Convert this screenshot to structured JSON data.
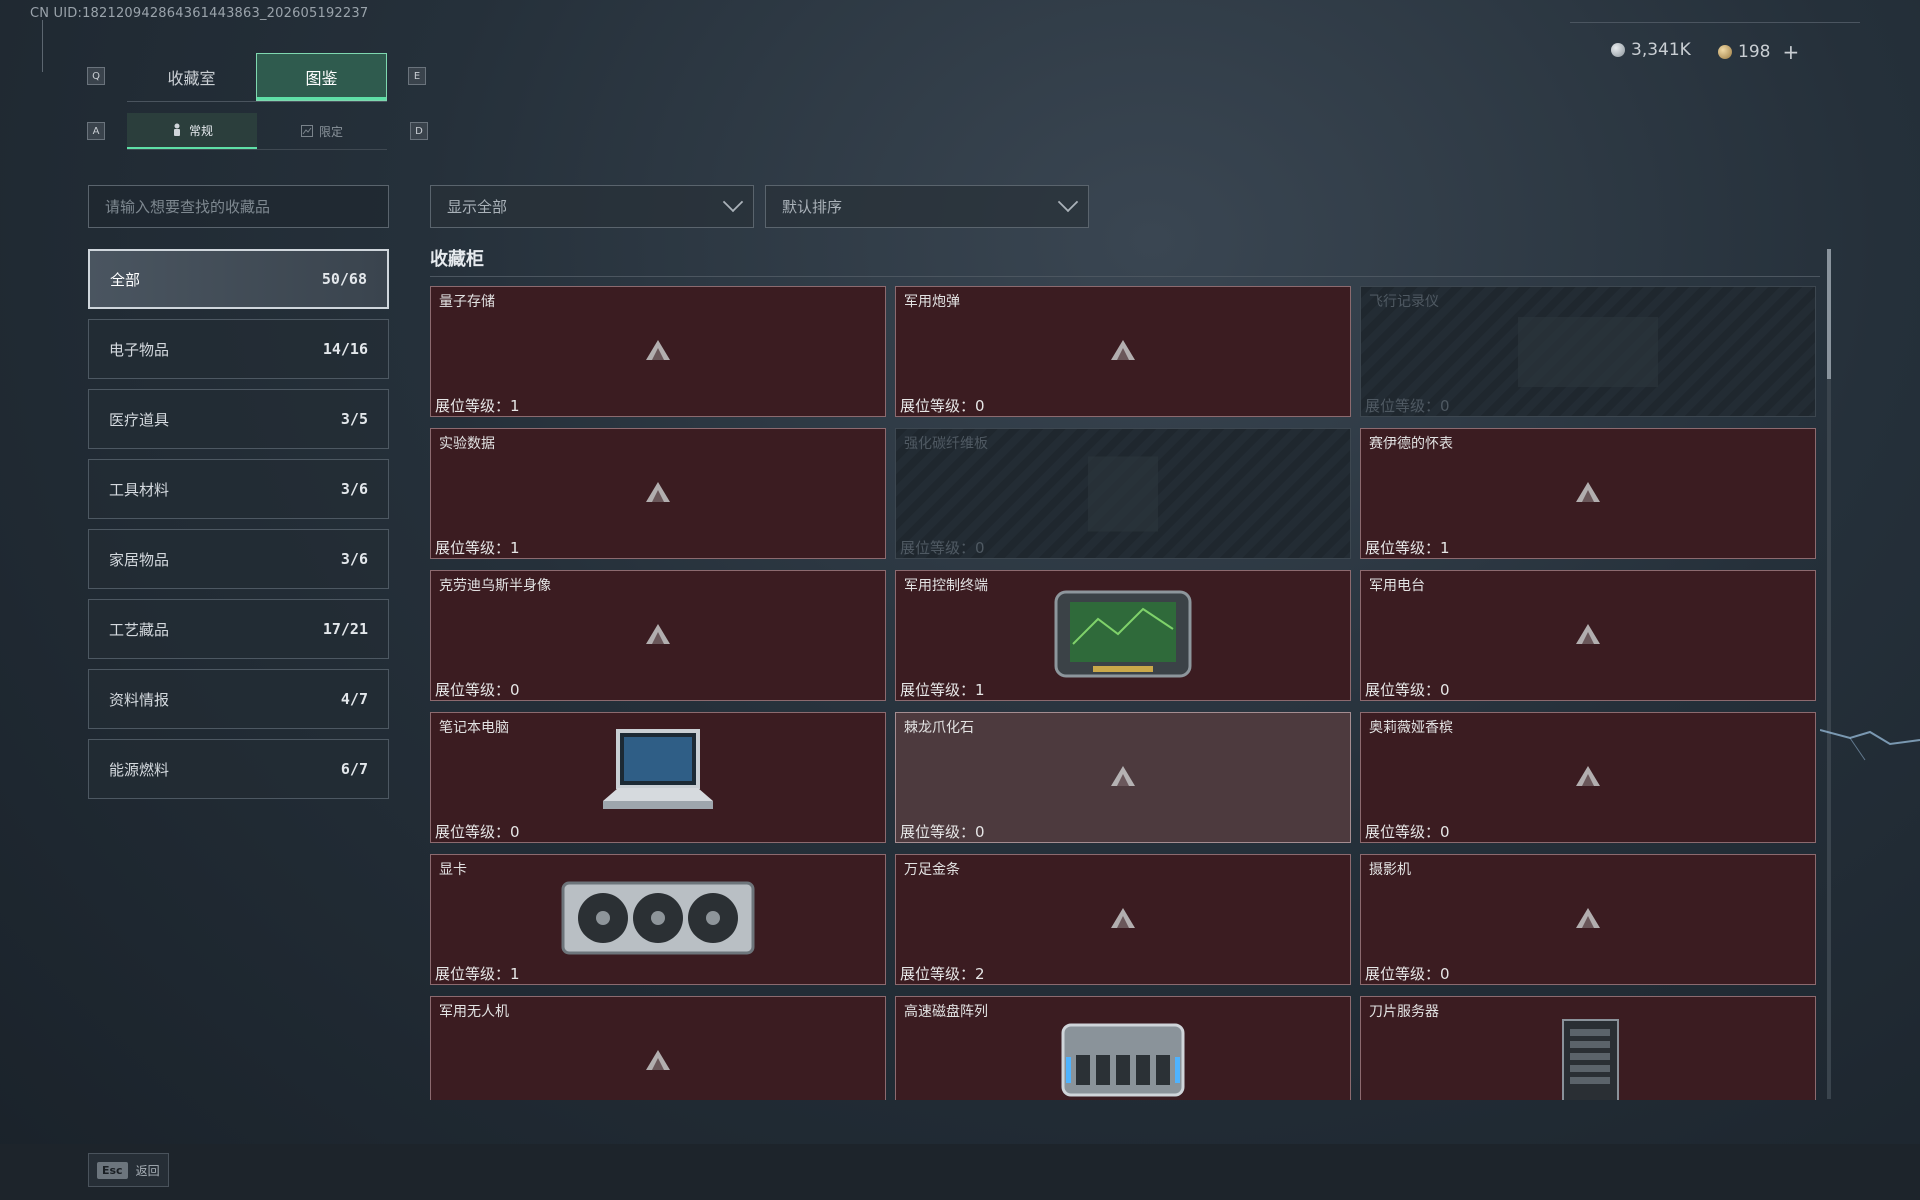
{
  "uid_text": "CN UID:18212094286436144386​3_202605192237",
  "keys": {
    "q": "Q",
    "e": "E",
    "a": "A",
    "d": "D"
  },
  "tabs": [
    {
      "label": "收藏室",
      "active": false
    },
    {
      "label": "图鉴",
      "active": true
    }
  ],
  "subtabs": [
    {
      "label": "常规",
      "icon": "figure-icon",
      "active": true
    },
    {
      "label": "限定",
      "icon": "image-icon",
      "active": false
    }
  ],
  "currency": [
    {
      "value": "3,341K",
      "icon": "silver-coin-icon",
      "color": "#b9c0c6"
    },
    {
      "value": "198",
      "icon": "gold-coin-icon",
      "color": "#c9a46a",
      "add": "+"
    }
  ],
  "search": {
    "placeholder": "请输入想要查找的收藏品"
  },
  "filters": {
    "display": "显示全部",
    "sort": "默认排序"
  },
  "categories": [
    {
      "label": "全部",
      "count": "50/68",
      "active": true
    },
    {
      "label": "电子物品",
      "count": "14/16"
    },
    {
      "label": "医疗道具",
      "count": "3/5"
    },
    {
      "label": "工具材料",
      "count": "3/6"
    },
    {
      "label": "家居物品",
      "count": "3/6"
    },
    {
      "label": "工艺藏品",
      "count": "17/21"
    },
    {
      "label": "资料情报",
      "count": "4/7"
    },
    {
      "label": "能源燃料",
      "count": "6/7"
    }
  ],
  "section_title": "收藏柜",
  "level_prefix": "展位等级：",
  "items": [
    {
      "name": "量子存储",
      "level": "1",
      "state": "normal",
      "image": "none"
    },
    {
      "name": "军用炮弹",
      "level": "0",
      "state": "normal",
      "image": "none"
    },
    {
      "name": "飞行记录仪",
      "level": "0",
      "state": "locked",
      "image": "none"
    },
    {
      "name": "实验数据",
      "level": "1",
      "state": "normal",
      "image": "none"
    },
    {
      "name": "强化碳纤维板",
      "level": "0",
      "state": "locked",
      "image": "none"
    },
    {
      "name": "赛伊德的怀表",
      "level": "1",
      "state": "normal",
      "image": "none"
    },
    {
      "name": "克劳迪乌斯半身像",
      "level": "0",
      "state": "normal",
      "image": "none"
    },
    {
      "name": "军用控制终端",
      "level": "1",
      "state": "normal",
      "image": "terminal"
    },
    {
      "name": "军用电台",
      "level": "0",
      "state": "normal",
      "image": "none"
    },
    {
      "name": "笔记本电脑",
      "level": "0",
      "state": "normal",
      "image": "laptop"
    },
    {
      "name": "棘龙爪化石",
      "level": "0",
      "state": "hover",
      "image": "none"
    },
    {
      "name": "奥莉薇娅香槟",
      "level": "0",
      "state": "normal",
      "image": "none"
    },
    {
      "name": "显卡",
      "level": "1",
      "state": "normal",
      "image": "gpu"
    },
    {
      "name": "万足金条",
      "level": "2",
      "state": "normal",
      "image": "none"
    },
    {
      "name": "摄影机",
      "level": "0",
      "state": "normal",
      "image": "none"
    },
    {
      "name": "军用无人机",
      "level": "",
      "state": "normal",
      "image": "none"
    },
    {
      "name": "高速磁盘阵列",
      "level": "",
      "state": "normal",
      "image": "disk-array"
    },
    {
      "name": "刀片服务器",
      "level": "",
      "state": "normal",
      "image": "server"
    }
  ],
  "footer": {
    "esc_key": "Esc",
    "esc_label": "返回"
  }
}
